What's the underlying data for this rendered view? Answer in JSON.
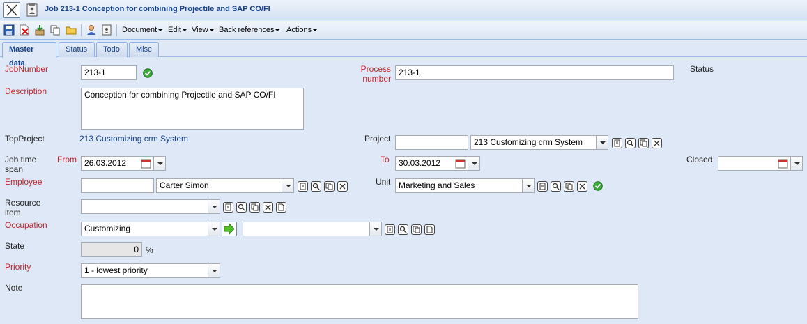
{
  "window": {
    "title": "Job 213-1 Conception for combining Projectile and SAP CO/FI"
  },
  "toolbar": {
    "menus": [
      "Document",
      "Edit",
      "View",
      "Back references",
      "Actions"
    ]
  },
  "tabs": [
    "Master data",
    "Status",
    "Todo",
    "Misc"
  ],
  "form": {
    "job_number_label": "JobNumber",
    "job_number_value": "213-1",
    "process_number_label_1": "Process",
    "process_number_label_2": "number",
    "process_number_value": "213-1",
    "status_label": "Status",
    "description_label": "Description",
    "description_value": "Conception for combining Projectile and SAP CO/FI",
    "topproject_label": "TopProject",
    "topproject_value": "213 Customizing crm System",
    "project_label": "Project",
    "project_code_value": "",
    "project_select_value": "213 Customizing crm System",
    "job_time_span_label_1": "Job time",
    "job_time_span_label_2": "span",
    "from_label": "From",
    "from_value": "26.03.2012",
    "to_label": "To",
    "to_value": "30.03.2012",
    "closed_label": "Closed",
    "closed_value": "",
    "employee_label": "Employee",
    "employee_code_value": "",
    "employee_select_value": "Carter Simon",
    "unit_label": "Unit",
    "unit_value": "Marketing and Sales",
    "resource_item_label_1": "Resource",
    "resource_item_label_2": "item",
    "resource_item_value": "",
    "occupation_label": "Occupation",
    "occupation_value": "Customizing",
    "occupation_detail_value": "",
    "state_label": "State",
    "state_value": "0",
    "state_unit": "%",
    "priority_label": "Priority",
    "priority_value": "1 - lowest priority",
    "note_label": "Note",
    "note_value": ""
  },
  "colors": {
    "required_label": "#c1272d",
    "link": "#15428b",
    "background": "#dfe8f6",
    "ok_green": "#3aa93a"
  }
}
